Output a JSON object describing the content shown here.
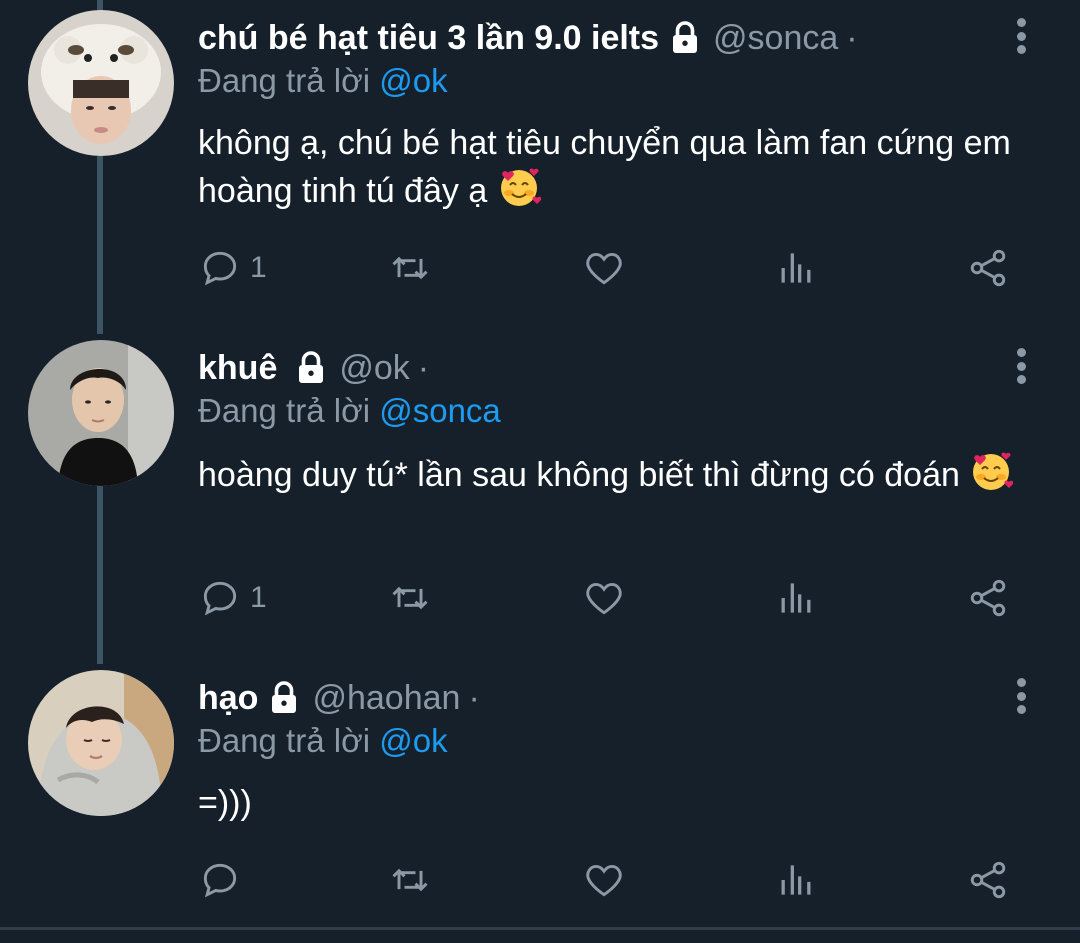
{
  "colors": {
    "background": "#15202b",
    "secondary_text": "#8b98a5",
    "mention": "#1d9bf0",
    "thread_line": "#3d5466"
  },
  "icons": {
    "lock": "lock-icon",
    "more": "more-vert-icon",
    "reply": "reply-icon",
    "retweet": "retweet-icon",
    "like": "heart-icon",
    "views": "analytics-icon",
    "share": "share-icon",
    "emoji": "smiling-face-with-hearts-emoji"
  },
  "tweets": [
    {
      "name": "chú bé hạt tiêu 3 lần 9.0 ielts",
      "handle": "@sonca",
      "dot": "·",
      "reply_prefix": "Đang trả lời ",
      "reply_mention": "@ok",
      "text": "không ạ, chú bé hạt tiêu chuyển qua làm fan cứng em hoàng tinh tú đây ạ ",
      "reply_count": "1"
    },
    {
      "name": "khuê",
      "handle": "@ok",
      "dot": "·",
      "reply_prefix": "Đang trả lời ",
      "reply_mention": "@sonca",
      "text": "hoàng duy tú* lần sau không biết thì đừng có đoán ",
      "reply_count": "1"
    },
    {
      "name": "hạo",
      "handle": "@haohan",
      "dot": "·",
      "reply_prefix": "Đang trả lời ",
      "reply_mention": "@ok",
      "text": "=)))",
      "reply_count": ""
    }
  ]
}
